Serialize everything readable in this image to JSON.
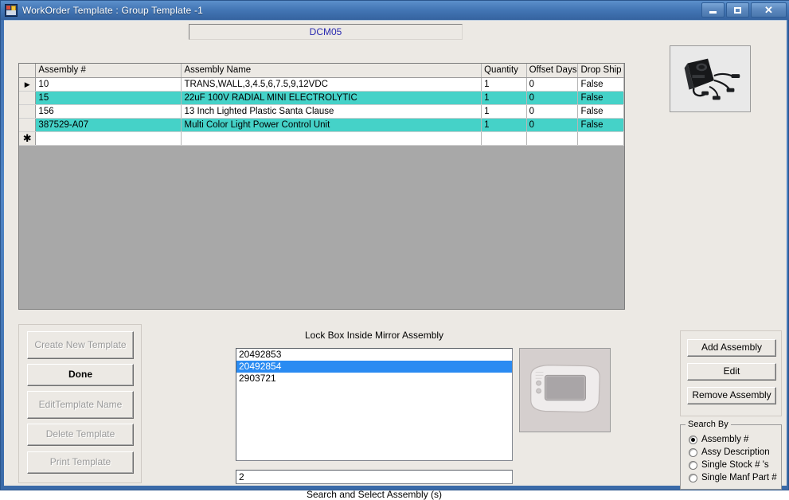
{
  "window": {
    "title": "WorkOrder Template : Group Template -1",
    "icon": "app-window-icon",
    "minimize_label": "–",
    "maximize_label": "□",
    "close_label": "✕",
    "chrome_color": "#4477b6",
    "client_color": "#ece9e4"
  },
  "template_field": {
    "value": "DCM05",
    "text_color": "#2a2ab0"
  },
  "grid": {
    "row_selector_current": "▶",
    "row_selector_new": "✱",
    "highlight_color": "#45d2c8",
    "columns": [
      "Assembly #",
      "Assembly Name",
      "Quantity",
      "Offset Days",
      "Drop Ship"
    ],
    "rows": [
      {
        "selector": "▶",
        "assembly": "10",
        "name": "TRANS,WALL,3,4.5,6,7.5,9,12VDC",
        "quantity": "1",
        "offset_days": "0",
        "drop_ship": "False",
        "highlighted": false
      },
      {
        "selector": "",
        "assembly": "15",
        "name": "22uF 100V RADIAL MINI ELECTROLYTIC",
        "quantity": "1",
        "offset_days": "0",
        "drop_ship": "False",
        "highlighted": true
      },
      {
        "selector": "",
        "assembly": "156",
        "name": "13 Inch Lighted Plastic Santa Clause",
        "quantity": "1",
        "offset_days": "0",
        "drop_ship": "False",
        "highlighted": false
      },
      {
        "selector": "",
        "assembly": "387529-A07",
        "name": "Multi Color Light Power Control Unit",
        "quantity": "1",
        "offset_days": "0",
        "drop_ship": "False",
        "highlighted": true
      },
      {
        "selector": "✱",
        "assembly": "",
        "name": "",
        "quantity": "",
        "offset_days": "",
        "drop_ship": "",
        "highlighted": false
      }
    ]
  },
  "thumbnails": {
    "top": "wall-transformer-photo",
    "bottom": "lock-box-mirror-photo"
  },
  "left_buttons": [
    {
      "label": "Create New Template",
      "enabled": false
    },
    {
      "label": "Done",
      "enabled": true
    },
    {
      "label": "EditTemplate Name",
      "enabled": false
    },
    {
      "label": "Delete Template",
      "enabled": false
    },
    {
      "label": "Print Template",
      "enabled": false
    }
  ],
  "center": {
    "title": "Lock Box Inside Mirror Assembly",
    "list_items": [
      {
        "value": "20492853",
        "selected": false
      },
      {
        "value": "20492854",
        "selected": true
      },
      {
        "value": "2903721",
        "selected": false
      }
    ],
    "search_value": "2",
    "search_placeholder": "",
    "search_label": "Search and Select Assembly (s)",
    "selection_color": "#2a8bf2"
  },
  "right_buttons": [
    {
      "label": "Add Assembly",
      "enabled": true
    },
    {
      "label": "Edit",
      "enabled": true
    },
    {
      "label": "Remove Assembly",
      "enabled": true
    }
  ],
  "search_by": {
    "legend": "Search By",
    "options": [
      {
        "label": "Assembly #",
        "selected": true
      },
      {
        "label": "Assy Description",
        "selected": false
      },
      {
        "label": "Single Stock # 's",
        "selected": false
      },
      {
        "label": "Single Manf Part #",
        "selected": false
      }
    ]
  }
}
